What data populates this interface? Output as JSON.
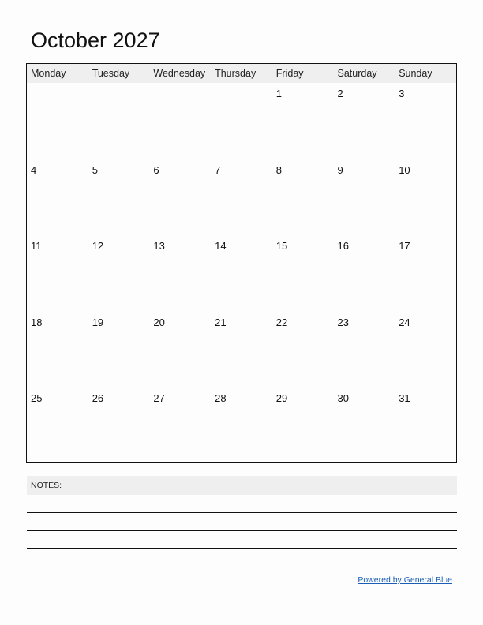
{
  "title": "October 2027",
  "calendar": {
    "weekdays": [
      "Monday",
      "Tuesday",
      "Wednesday",
      "Thursday",
      "Friday",
      "Saturday",
      "Sunday"
    ],
    "weeks": [
      [
        "",
        "",
        "",
        "",
        "1",
        "2",
        "3"
      ],
      [
        "4",
        "5",
        "6",
        "7",
        "8",
        "9",
        "10"
      ],
      [
        "11",
        "12",
        "13",
        "14",
        "15",
        "16",
        "17"
      ],
      [
        "18",
        "19",
        "20",
        "21",
        "22",
        "23",
        "24"
      ],
      [
        "25",
        "26",
        "27",
        "28",
        "29",
        "30",
        "31"
      ]
    ]
  },
  "notes": {
    "label": "NOTES:",
    "line_count": 4
  },
  "footer": {
    "link_text": "Powered by General Blue",
    "link_color": "#1a5fb4"
  },
  "colors": {
    "header_band": "#efefef",
    "border": "#111111",
    "background": "#fdfdfd"
  }
}
